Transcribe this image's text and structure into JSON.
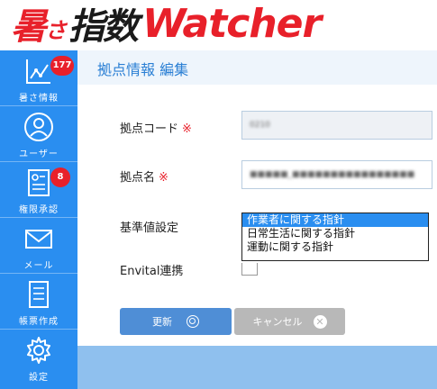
{
  "logo": {
    "jp_part1": "暑",
    "jp_part2": "さ",
    "jp_part3": "指数",
    "en_part": "Watcher"
  },
  "sidebar": {
    "items": [
      {
        "label": "暑さ情報",
        "badge": "177",
        "icon": "chart-icon"
      },
      {
        "label": "ユーザー",
        "icon": "user-icon"
      },
      {
        "label": "権限承認",
        "badge": "8",
        "icon": "approval-icon"
      },
      {
        "label": "メール",
        "icon": "mail-icon"
      },
      {
        "label": "帳票作成",
        "icon": "report-icon"
      },
      {
        "label": "設定",
        "icon": "gear-icon"
      }
    ]
  },
  "page": {
    "title": "拠点情報 編集"
  },
  "form": {
    "code_label": "拠点コード",
    "code_value": "0210",
    "name_label": "拠点名",
    "name_value": "■■■■■_■■■■■■■■■■■■■■■■",
    "required_mark": "※",
    "standard_label": "基準値設定",
    "standard_options": [
      "作業者に関する指針",
      "日常生活に関する指針",
      "運動に関する指針"
    ],
    "envital_label": "Envital連携"
  },
  "buttons": {
    "update": "更新",
    "cancel": "キャンセル"
  },
  "colors": {
    "brand_red": "#e8202a",
    "sidebar_blue": "#2a8ef0",
    "title_blue": "#2a7fd4"
  }
}
